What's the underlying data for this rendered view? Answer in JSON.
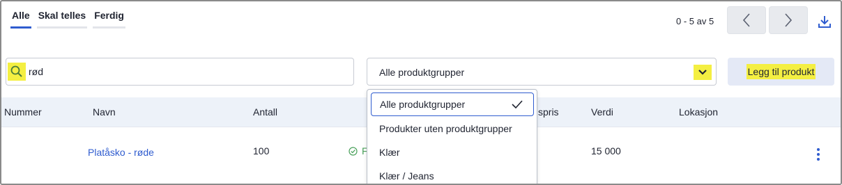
{
  "tabs": [
    {
      "label": "Alle",
      "active": true
    },
    {
      "label": "Skal telles",
      "active": false
    },
    {
      "label": "Ferdig",
      "active": false
    }
  ],
  "pager": {
    "text": "0 - 5 av 5",
    "prev_icon": "chevron-left-icon",
    "next_icon": "chevron-right-icon"
  },
  "download_icon": "download-icon",
  "search": {
    "value": "rød",
    "icon": "search-icon"
  },
  "filter": {
    "selected": "Alle produktgrupper",
    "icon": "chevron-down-icon"
  },
  "add_button": {
    "label": "Legg til produkt"
  },
  "table": {
    "columns": [
      "Nummer",
      "Navn",
      "Antall",
      "spris",
      "Verdi",
      "Lokasjon"
    ],
    "rows": [
      {
        "number": "",
        "name": "Platåsko - røde",
        "quantity": "100",
        "status": "F",
        "value": "15 000",
        "location": ""
      }
    ]
  },
  "dropdown": {
    "options": [
      {
        "label": "Alle produktgrupper",
        "selected": true
      },
      {
        "label": "Produkter uten produktgrupper",
        "selected": false
      },
      {
        "label": "Klær",
        "selected": false
      },
      {
        "label": "Klær / Jeans",
        "selected": false
      }
    ]
  },
  "colors": {
    "accent": "#2f5ccf",
    "highlight": "#f4ef42",
    "header_bg": "#edf2f9",
    "status_green": "#49a05a"
  }
}
